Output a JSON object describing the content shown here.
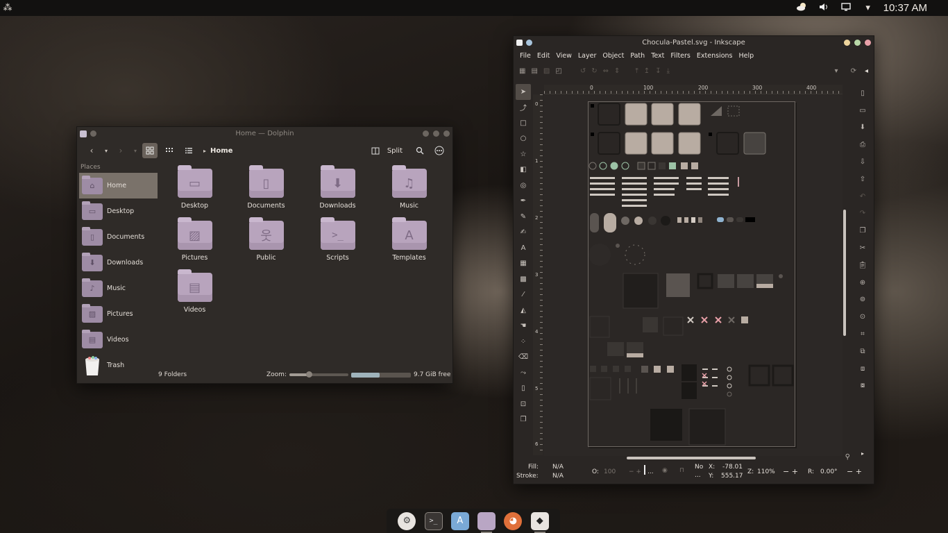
{
  "panel": {
    "clock": "10:37 AM",
    "tray_icons": [
      "weather-icon",
      "volume-icon",
      "display-icon",
      "chevron-down-icon"
    ]
  },
  "dolphin": {
    "title": "Home — Dolphin",
    "split_label": "Split",
    "breadcrumb": "Home",
    "places_header": "Places",
    "places": [
      {
        "label": "Home",
        "icon": "home-icon",
        "selected": true
      },
      {
        "label": "Desktop",
        "icon": "desktop-icon"
      },
      {
        "label": "Documents",
        "icon": "document-icon"
      },
      {
        "label": "Downloads",
        "icon": "download-icon"
      },
      {
        "label": "Music",
        "icon": "music-icon"
      },
      {
        "label": "Pictures",
        "icon": "picture-icon"
      },
      {
        "label": "Videos",
        "icon": "film-icon"
      },
      {
        "label": "Trash",
        "icon": "trash-icon"
      }
    ],
    "folders": [
      {
        "label": "Desktop",
        "icon": "desktop-icon"
      },
      {
        "label": "Documents",
        "icon": "document-icon"
      },
      {
        "label": "Downloads",
        "icon": "download-icon"
      },
      {
        "label": "Music",
        "icon": "music-icon"
      },
      {
        "label": "Pictures",
        "icon": "picture-icon"
      },
      {
        "label": "Public",
        "icon": "people-icon"
      },
      {
        "label": "Scripts",
        "icon": "terminal-icon"
      },
      {
        "label": "Templates",
        "icon": "template-icon"
      },
      {
        "label": "Videos",
        "icon": "film-icon"
      }
    ],
    "status": {
      "summary": "9 Folders",
      "zoom_label": "Zoom:",
      "free_space": "9.7 GiB free",
      "space_used_fraction": 0.48
    }
  },
  "inkscape": {
    "title": "Chocula-Pastel.svg - Inkscape",
    "menu": [
      "File",
      "Edit",
      "View",
      "Layer",
      "Object",
      "Path",
      "Text",
      "Filters",
      "Extensions",
      "Help"
    ],
    "ruler_h": [
      "0",
      "100",
      "200",
      "300",
      "400"
    ],
    "ruler_v": [
      "0",
      "1",
      "2",
      "3",
      "4",
      "5",
      "6"
    ],
    "status": {
      "fill_label": "Fill:",
      "fill_value": "N/A",
      "stroke_label": "Stroke:",
      "stroke_value": "N/A",
      "opacity_label": "O:",
      "opacity_value": "100",
      "layer_dots": "...",
      "no_label": "No",
      "no_dots": "...",
      "x_label": "X:",
      "x_value": "-78.01",
      "y_label": "Y:",
      "y_value": "555.17",
      "zoom_label": "Z:",
      "zoom_value": "110%",
      "rotate_label": "R:",
      "rotate_value": "0.00°"
    }
  },
  "dock": [
    {
      "name": "settings-icon",
      "color": "#e8e4e0"
    },
    {
      "name": "terminal-icon",
      "color": "#3a3634"
    },
    {
      "name": "app-store-icon",
      "color": "#7aa9d6"
    },
    {
      "name": "file-manager-icon",
      "color": "#b9a6c4"
    },
    {
      "name": "firefox-icon",
      "color": "#e0703a"
    },
    {
      "name": "inkscape-icon",
      "color": "#e8e4e0"
    }
  ]
}
